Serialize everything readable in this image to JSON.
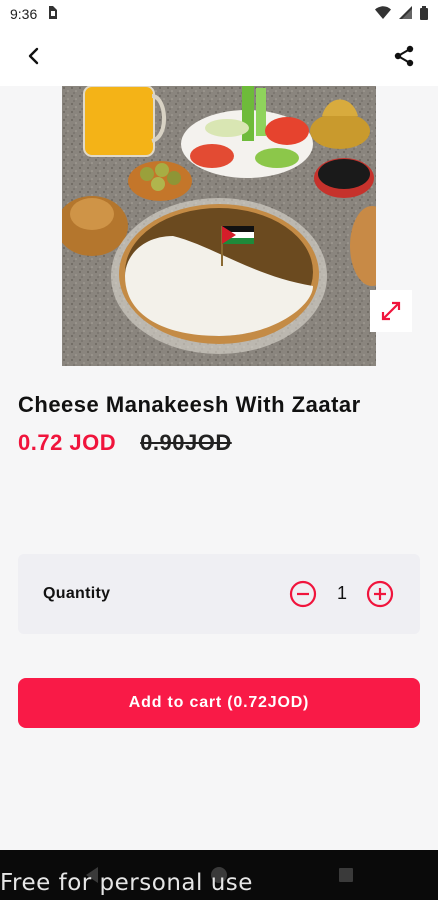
{
  "status_bar": {
    "time": "9:36",
    "icons": [
      "sim-card-icon",
      "wifi-icon",
      "signal-icon",
      "battery-icon"
    ]
  },
  "app_bar": {
    "back_icon": "chevron-left-icon",
    "share_icon": "share-icon"
  },
  "product": {
    "title": "Cheese Manakeesh With Zaatar",
    "price_current": "0.72 JOD",
    "price_old": "0.90JOD",
    "expand_icon": "expand-icon"
  },
  "quantity": {
    "label": "Quantity",
    "value": "1",
    "minus_icon": "minus-circle-icon",
    "plus_icon": "plus-circle-icon"
  },
  "cart": {
    "button_label": "Add to cart (0.72JOD)"
  },
  "watermark": "Free for personal use",
  "colors": {
    "accent": "#f0143c",
    "button": "#f91a47",
    "background": "#f6f6f7",
    "card": "#efeff3"
  }
}
